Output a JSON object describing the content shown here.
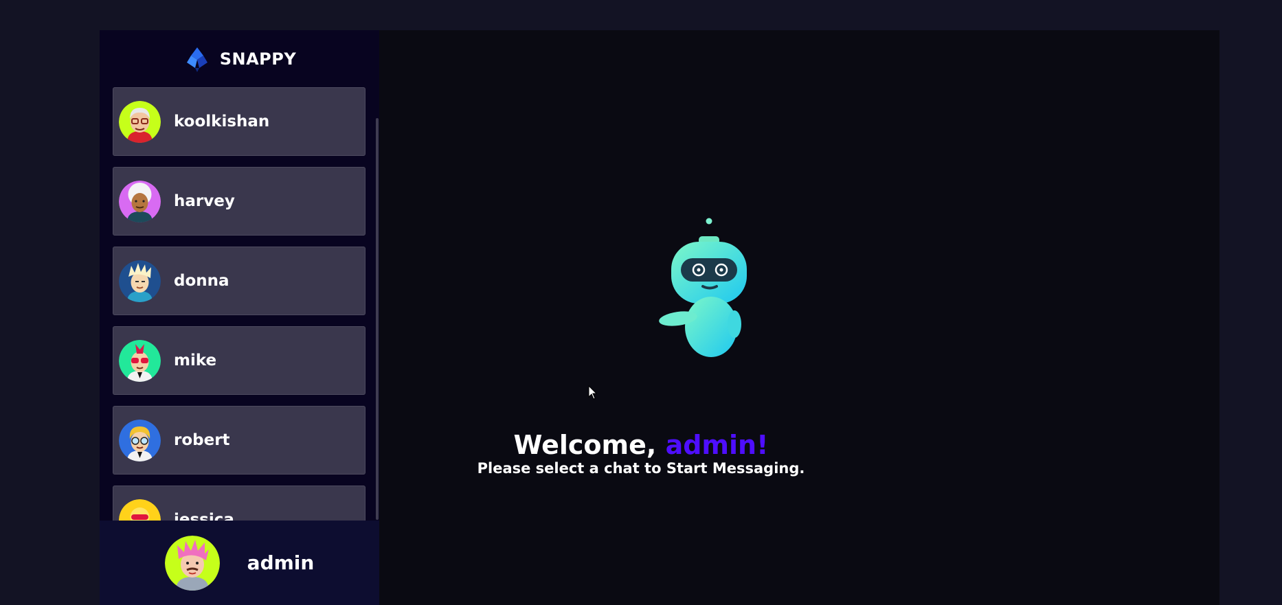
{
  "brand": {
    "name": "SNAPPY",
    "logo_icon": "snappy-logo-icon"
  },
  "contacts": [
    {
      "name": "koolkishan",
      "avatar_icon": "avatar-glasses-icon",
      "avatar_bg": "#c6ff1a"
    },
    {
      "name": "harvey",
      "avatar_icon": "avatar-white-hair-icon",
      "avatar_bg": "#d86bf2"
    },
    {
      "name": "donna",
      "avatar_icon": "avatar-spiky-hair-icon",
      "avatar_bg": "#1f4f8f"
    },
    {
      "name": "mike",
      "avatar_icon": "avatar-red-glasses-icon",
      "avatar_bg": "#22e89a"
    },
    {
      "name": "robert",
      "avatar_icon": "avatar-blonde-glasses-icon",
      "avatar_bg": "#2f6fe0"
    },
    {
      "name": "jessica",
      "avatar_icon": "avatar-yellow-icon",
      "avatar_bg": "#ffd21a"
    }
  ],
  "current_user": {
    "name": "admin",
    "avatar_icon": "avatar-pink-hair-icon",
    "avatar_bg": "#c6ff1a"
  },
  "welcome": {
    "greeting": "Welcome, ",
    "username": "admin!",
    "subtitle": "Please select a chat to Start Messaging.",
    "illustration_icon": "robot-icon"
  },
  "colors": {
    "accent": "#4e0eff",
    "sidebar_bg": "#080420",
    "contact_bg": "#ffffff34"
  }
}
